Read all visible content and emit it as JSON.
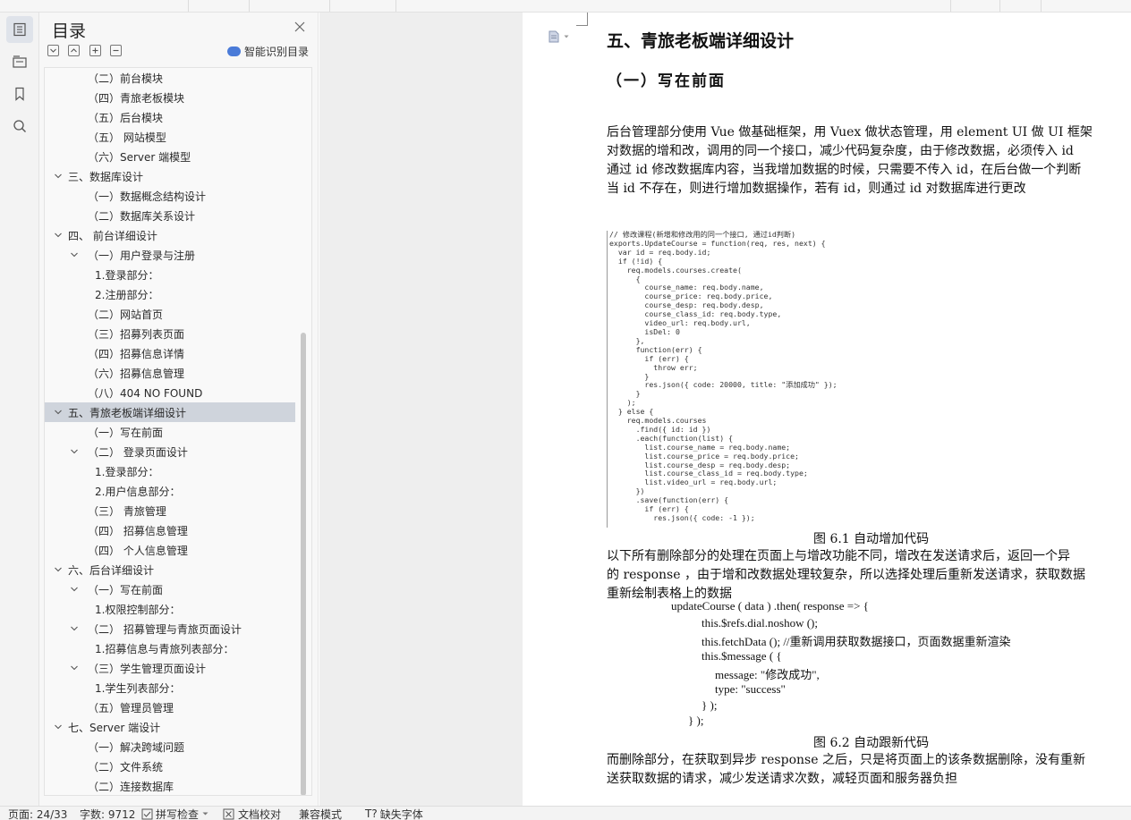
{
  "outline": {
    "title": "目录",
    "smart_label": "智能识别目录",
    "items": [
      {
        "label": "（二）前台模块",
        "level": 2,
        "chevron": false
      },
      {
        "label": "（四）青旅老板模块",
        "level": 2,
        "chevron": false
      },
      {
        "label": "（五）后台模块",
        "level": 2,
        "chevron": false
      },
      {
        "label": "（五）  网站模型",
        "level": 2,
        "chevron": false
      },
      {
        "label": "（六）Server 端模型",
        "level": 2,
        "chevron": false
      },
      {
        "label": "三、数据库设计",
        "level": 1,
        "chevron": true
      },
      {
        "label": "（一）数据概念结构设计",
        "level": 2,
        "chevron": false
      },
      {
        "label": "（二）数据库关系设计",
        "level": 2,
        "chevron": false
      },
      {
        "label": "四、 前台详细设计",
        "level": 1,
        "chevron": true
      },
      {
        "label": "（一）用户登录与注册",
        "level": 2,
        "chevron": true
      },
      {
        "label": "1.登录部分：",
        "level": 3,
        "chevron": false
      },
      {
        "label": "2.注册部分：",
        "level": 3,
        "chevron": false
      },
      {
        "label": "（二）网站首页",
        "level": 2,
        "chevron": false
      },
      {
        "label": "（三）招募列表页面",
        "level": 2,
        "chevron": false
      },
      {
        "label": "（四）招募信息详情",
        "level": 2,
        "chevron": false
      },
      {
        "label": "（六）招募信息管理",
        "level": 2,
        "chevron": false
      },
      {
        "label": "（八）404 NO FOUND",
        "level": 2,
        "chevron": false
      },
      {
        "label": "五、青旅老板端详细设计",
        "level": 1,
        "chevron": true,
        "selected": true
      },
      {
        "label": "（一）写在前面",
        "level": 2,
        "chevron": false
      },
      {
        "label": "（二）  登录页面设计",
        "level": 2,
        "chevron": true
      },
      {
        "label": "1.登录部分：",
        "level": 3,
        "chevron": false
      },
      {
        "label": "2.用户信息部分：",
        "level": 3,
        "chevron": false
      },
      {
        "label": "（三）  青旅管理",
        "level": 2,
        "chevron": false
      },
      {
        "label": "（四）  招募信息管理",
        "level": 2,
        "chevron": false
      },
      {
        "label": "（四）  个人信息管理",
        "level": 2,
        "chevron": false
      },
      {
        "label": "六、后台详细设计",
        "level": 1,
        "chevron": true
      },
      {
        "label": "（一）写在前面",
        "level": 2,
        "chevron": true
      },
      {
        "label": "1.权限控制部分：",
        "level": 3,
        "chevron": false
      },
      {
        "label": "（二）  招募管理与青旅页面设计",
        "level": 2,
        "chevron": true
      },
      {
        "label": "1.招募信息与青旅列表部分：",
        "level": 3,
        "chevron": false
      },
      {
        "label": "（三）学生管理页面设计",
        "level": 2,
        "chevron": true
      },
      {
        "label": "1.学生列表部分：",
        "level": 3,
        "chevron": false
      },
      {
        "label": "（五）管理员管理",
        "level": 2,
        "chevron": false
      },
      {
        "label": "七、Server 端设计",
        "level": 1,
        "chevron": true
      },
      {
        "label": "（一）解决跨域问题",
        "level": 2,
        "chevron": false
      },
      {
        "label": "（二）文件系统",
        "level": 2,
        "chevron": false
      },
      {
        "label": "（二）连接数据库",
        "level": 2,
        "chevron": false
      }
    ]
  },
  "document": {
    "heading": "五、青旅老板端详细设计",
    "subheading": "（一）写在前面",
    "para1": [
      "后台管理部分使用 Vue 做基础框架，用 Vuex 做状态管理，用 element UI 做 UI 框架",
      "对数据的增和改，调用的同一个接口，减少代码复杂度，由于修改数据，必须传入 id",
      "通过 id 修改数据库内容，当我增加数据的时候，只需要不传入 id，在后台做一个判断",
      "当 id 不存在，则进行增加数据操作，若有 id，则通过 id 对数据库进行更改"
    ],
    "code1": "// 修改课程(新增和修改用的同一个接口, 通过id判断)\nexports.UpdateCourse = function(req, res, next) {\n  var id = req.body.id;\n  if (!id) {\n    req.models.courses.create(\n      {\n        course_name: req.body.name,\n        course_price: req.body.price,\n        course_desp: req.body.desp,\n        course_class_id: req.body.type,\n        video_url: req.body.url,\n        isDel: 0\n      },\n      function(err) {\n        if (err) {\n          throw err;\n        }\n        res.json({ code: 20000, title: \"添加成功\" });\n      }\n    );\n  } else {\n    req.models.courses\n      .find({ id: id })\n      .each(function(list) {\n        list.course_name = req.body.name;\n        list.course_price = req.body.price;\n        list.course_desp = req.body.desp;\n        list.course_class_id = req.body.type;\n        list.video_url = req.body.url;\n      })\n      .save(function(err) {\n        if (err) {\n          res.json({ code: -1 });",
    "caption1": "图 6.1 自动增加代码",
    "para2": [
      "以下所有删除部分的处理在页面上与增改功能不同，增改在发送请求后，返回一个异",
      "的 response ，由于增和改数据处理较复杂，所以选择处理后重新发送请求，获取数据",
      "重新绘制表格上的数据"
    ],
    "code2": [
      "updateCourse ( data ) .then( response    =>    {",
      "this.$refs.dial.noshow ();",
      "this.fetchData ();            //重新调用获取数据接口，页面数据重新渲染",
      "this.$message ( {",
      "message: \"修改成功\",",
      "type: \"success\"",
      "} );",
      "} );"
    ],
    "caption2": "图 6.2 自动跟新代码",
    "para3": [
      "而删除部分，在获取到异步 response 之后，只是将页面上的该条数据删除，没有重新",
      "送获取数据的请求，减少发送请求次数，减轻页面和服务器负担"
    ]
  },
  "status": {
    "page": "页面: 24/33",
    "words": "字数: 9712",
    "spell": "拼写检查",
    "proof": "文档校对",
    "compat": "兼容模式",
    "missing_font": "缺失字体"
  }
}
